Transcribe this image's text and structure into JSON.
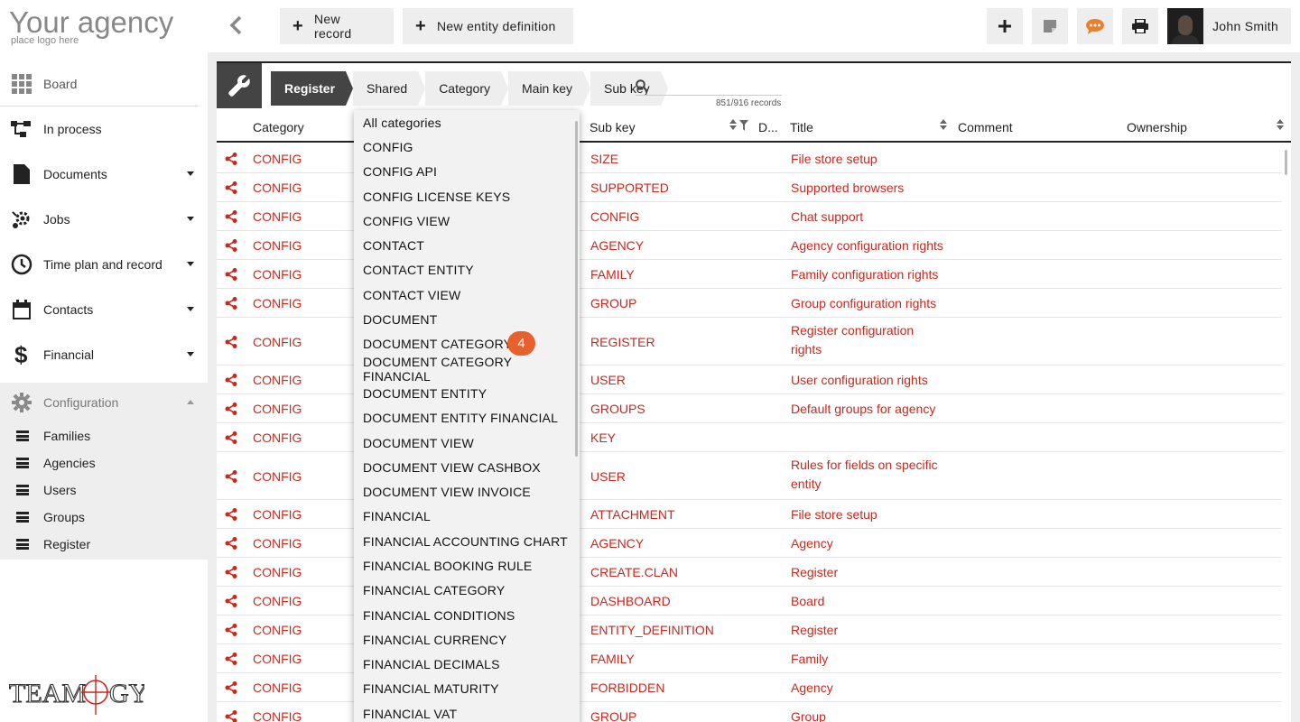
{
  "logo": {
    "title": "Your agency",
    "subtitle": "place logo here"
  },
  "nav": {
    "board": "Board",
    "in_process": "In process",
    "documents": "Documents",
    "jobs": "Jobs",
    "time_plan": "Time plan and record",
    "contacts": "Contacts",
    "financial": "Financial",
    "configuration": "Configuration",
    "sub_items": [
      "Families",
      "Agencies",
      "Users",
      "Groups",
      "Register"
    ]
  },
  "brand": "TEAMOGY",
  "toolbar": {
    "new_record": "New record",
    "new_entity_definition": "New entity definition"
  },
  "user": {
    "name": "John Smith"
  },
  "breadcrumbs": [
    "Register",
    "Shared",
    "Category",
    "Main key",
    "Sub key"
  ],
  "search": {
    "placeholder": "",
    "records": "851/916 records"
  },
  "columns": {
    "category": "Category",
    "sub_key": "Sub key",
    "d": "D...",
    "title": "Title",
    "comment": "Comment",
    "ownership": "Ownership"
  },
  "rows": [
    {
      "category": "CONFIG",
      "sub_key": "SIZE",
      "title": "File store setup"
    },
    {
      "category": "CONFIG",
      "sub_key": "SUPPORTED",
      "title": "Supported browsers"
    },
    {
      "category": "CONFIG",
      "sub_key": "CONFIG",
      "title": "Chat support"
    },
    {
      "category": "CONFIG",
      "sub_key": "AGENCY",
      "title": "Agency configuration rights"
    },
    {
      "category": "CONFIG",
      "sub_key": "FAMILY",
      "title": "Family configuration rights"
    },
    {
      "category": "CONFIG",
      "sub_key": "GROUP",
      "title": "Group configuration rights"
    },
    {
      "category": "CONFIG",
      "sub_key": "REGISTER",
      "title": "Register configuration",
      "title2": "rights",
      "tall": true
    },
    {
      "category": "CONFIG",
      "sub_key": "USER",
      "title": "User configuration rights"
    },
    {
      "category": "CONFIG",
      "sub_key": "GROUPS",
      "title": "Default groups for agency"
    },
    {
      "category": "CONFIG",
      "sub_key": "KEY",
      "title": ""
    },
    {
      "category": "CONFIG",
      "sub_key": "USER",
      "title": "Rules for fields on specific",
      "title2": "entity",
      "tall": true
    },
    {
      "category": "CONFIG",
      "sub_key": "ATTACHMENT",
      "title": "File store setup"
    },
    {
      "category": "CONFIG",
      "sub_key": "AGENCY",
      "title": "Agency"
    },
    {
      "category": "CONFIG",
      "sub_key": "CREATE.CLAN",
      "title": "Register"
    },
    {
      "category": "CONFIG",
      "sub_key": "DASHBOARD",
      "title": "Board"
    },
    {
      "category": "CONFIG",
      "sub_key": "ENTITY_DEFINITION",
      "title": "Register"
    },
    {
      "category": "CONFIG",
      "sub_key": "FAMILY",
      "title": "Family"
    },
    {
      "category": "CONFIG",
      "sub_key": "FORBIDDEN",
      "title": "Agency"
    },
    {
      "category": "CONFIG",
      "sub_key": "GROUP",
      "title": "Group"
    }
  ],
  "dropdown": {
    "items": [
      "All categories",
      "CONFIG",
      "CONFIG API",
      "CONFIG LICENSE KEYS",
      "CONFIG VIEW",
      "CONTACT",
      "CONTACT ENTITY",
      "CONTACT VIEW",
      "DOCUMENT",
      "DOCUMENT CATEGORY",
      "DOCUMENT CATEGORY FINANCIAL",
      "DOCUMENT ENTITY",
      "DOCUMENT ENTITY FINANCIAL",
      "DOCUMENT VIEW",
      "DOCUMENT VIEW CASHBOX",
      "DOCUMENT VIEW INVOICE",
      "FINANCIAL",
      "FINANCIAL ACCOUNTING CHART",
      "FINANCIAL BOOKING RULE",
      "FINANCIAL CATEGORY",
      "FINANCIAL CONDITIONS",
      "FINANCIAL CURRENCY",
      "FINANCIAL DECIMALS",
      "FINANCIAL MATURITY",
      "FINANCIAL VAT"
    ],
    "badge": "4"
  },
  "colors": {
    "accent": "#c8281e",
    "badge": "#e8602c",
    "dark": "#444444"
  }
}
